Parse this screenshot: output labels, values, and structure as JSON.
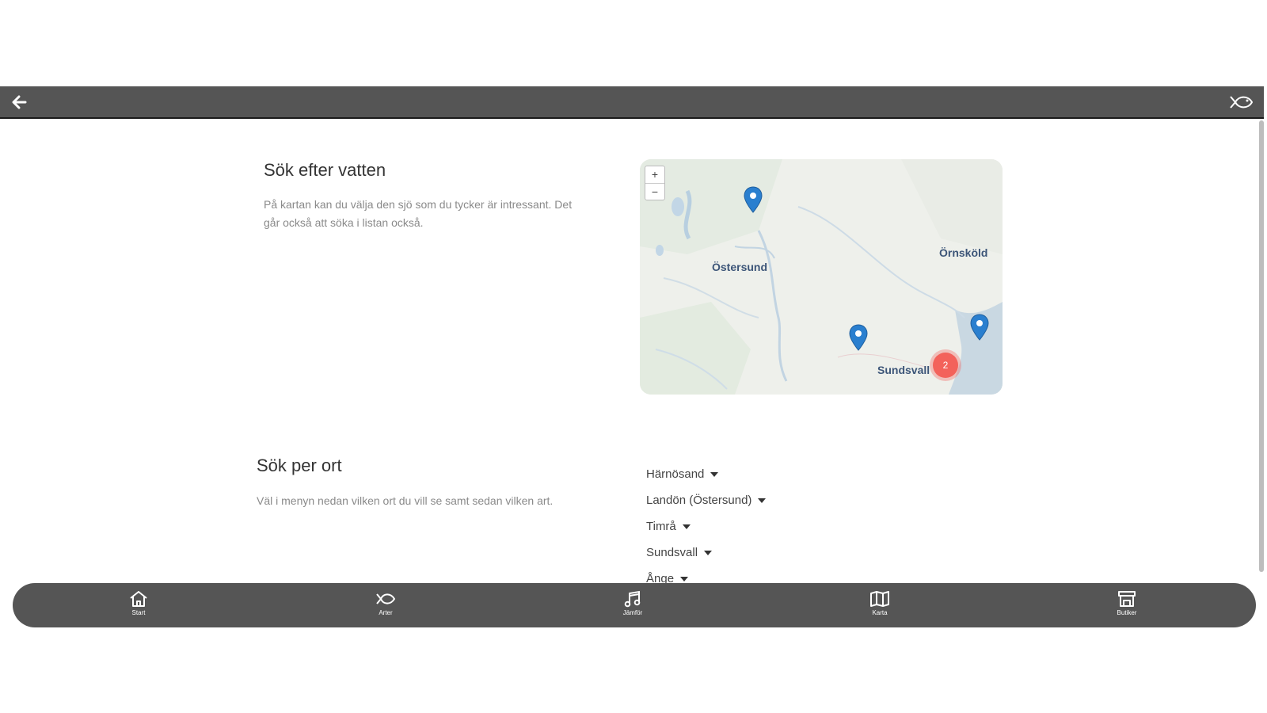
{
  "search_water": {
    "title": "Sök efter vatten",
    "description": "På kartan kan du välja den sjö som du tycker är intressant. Det går också att söka i listan också."
  },
  "map": {
    "zoom_in": "+",
    "zoom_out": "−",
    "cities": [
      "Östersund",
      "Örnsköld",
      "Sundsvall"
    ],
    "cluster_count": "2"
  },
  "search_place": {
    "title": "Sök per ort",
    "description": "Väl i menyn nedan vilken ort du vill se samt sedan vilken art.",
    "places": [
      "Härnösand",
      "Landön (Östersund)",
      "Timrå",
      "Sundsvall",
      "Ånge"
    ]
  },
  "nav": {
    "items": [
      {
        "label": "Start",
        "icon": "home-icon"
      },
      {
        "label": "Arter",
        "icon": "fish-icon"
      },
      {
        "label": "Jämför",
        "icon": "music-note-icon"
      },
      {
        "label": "Karta",
        "icon": "map-icon"
      },
      {
        "label": "Butiker",
        "icon": "store-icon"
      }
    ]
  },
  "colors": {
    "bar": "#555555",
    "pin": "#2a7fcf",
    "cluster": "#f3625b"
  }
}
